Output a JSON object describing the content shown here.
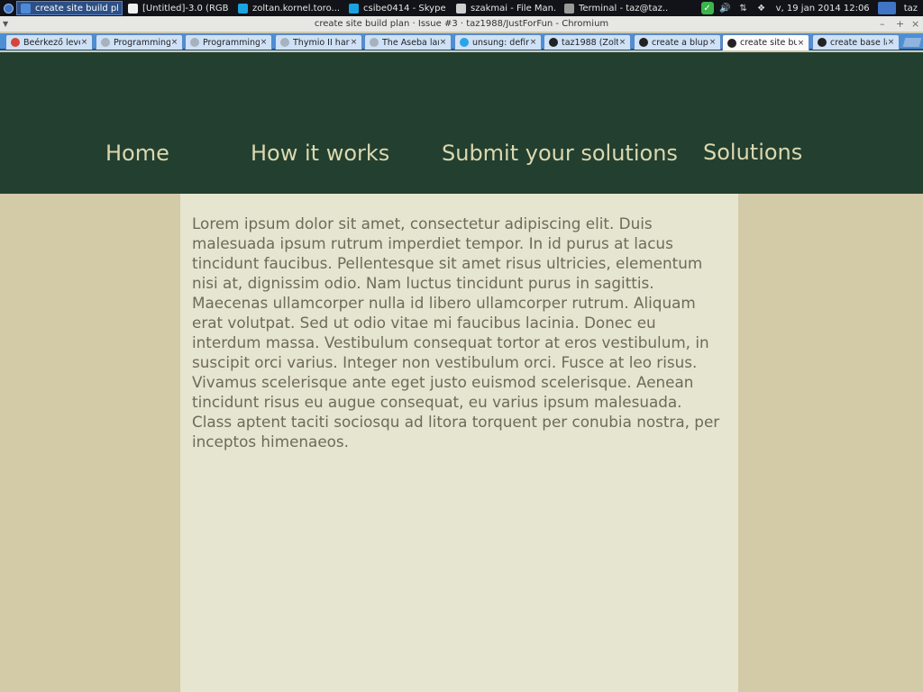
{
  "taskbar": {
    "tasks": [
      {
        "label": "create site build pl...",
        "active": true,
        "icon": "chromium-icon",
        "color": "#4f8ad6"
      },
      {
        "label": "[Untitled]-3.0 (RGB...",
        "active": false,
        "icon": "gimp-icon",
        "color": "#f0f0f0"
      },
      {
        "label": "zoltan.kornel.toro...",
        "active": false,
        "icon": "skype-icon",
        "color": "#1aa3e0"
      },
      {
        "label": "csibe0414 - Skype™",
        "active": false,
        "icon": "skype-icon",
        "color": "#1aa3e0"
      },
      {
        "label": "szakmai - File Man...",
        "active": false,
        "icon": "folder-icon",
        "color": "#cfcfcf"
      },
      {
        "label": "Terminal - taz@taz...",
        "active": false,
        "icon": "terminal-icon",
        "color": "#9a9a9a"
      }
    ],
    "clock": "v, 19 jan 2014 12:06",
    "user": "taz"
  },
  "window": {
    "title": "create site build plan · Issue #3 · taz1988/JustForFun - Chromium",
    "controls": {
      "minimize": "–",
      "maximize": "+",
      "close": "×"
    }
  },
  "tabs": [
    {
      "label": "Beérkező leve",
      "icon": "gmail-icon",
      "color": "#d44638",
      "active": false
    },
    {
      "label": "Programming",
      "icon": "page-icon",
      "color": "#a7b2bd",
      "active": false
    },
    {
      "label": "Programming",
      "icon": "page-icon",
      "color": "#a7b2bd",
      "active": false
    },
    {
      "label": "Thymio II har",
      "icon": "page-icon",
      "color": "#a7b2bd",
      "active": false
    },
    {
      "label": "The Aseba lar",
      "icon": "page-icon",
      "color": "#a7b2bd",
      "active": false
    },
    {
      "label": "unsung: defir",
      "icon": "loading-icon",
      "color": "#2aa4e8",
      "active": false
    },
    {
      "label": "taz1988 (Zolt",
      "icon": "github-icon",
      "color": "#222222",
      "active": false
    },
    {
      "label": "create a blup",
      "icon": "github-icon",
      "color": "#222222",
      "active": false
    },
    {
      "label": "create site bu",
      "icon": "github-icon",
      "color": "#222222",
      "active": true
    },
    {
      "label": "create base la",
      "icon": "github-icon",
      "color": "#222222",
      "active": false
    }
  ],
  "tab_close_glyph": "×",
  "nav": {
    "home": "Home",
    "how_it_works": "How it works",
    "submit": "Submit your solutions",
    "solutions": "Solutions"
  },
  "content": {
    "body": "Lorem ipsum dolor sit amet, consectetur adipiscing elit. Duis malesuada ipsum rutrum imperdiet tempor. In id purus at lacus tincidunt faucibus. Pellentesque sit amet risus ultricies, elementum nisi at, dignissim odio. Nam luctus tincidunt purus in sagittis. Maecenas ullamcorper nulla id libero ullamcorper rutrum. Aliquam erat volutpat. Sed ut odio vitae mi faucibus lacinia. Donec eu interdum massa. Vestibulum consequat tortor at eros vestibulum, in suscipit orci varius. Integer non vestibulum orci. Fusce at leo risus. Vivamus scelerisque ante eget justo euismod scelerisque. Aenean tincidunt risus eu augue consequat, eu varius ipsum malesuada. Class aptent taciti sociosqu ad litora torquent per conubia nostra, per inceptos himenaeos."
  },
  "colors": {
    "header_bg": "#233f2f",
    "nav_text": "#dad8b0",
    "page_bg": "#d3caa8",
    "content_bg": "#e6e5cf",
    "body_text": "#6f6a5a"
  }
}
